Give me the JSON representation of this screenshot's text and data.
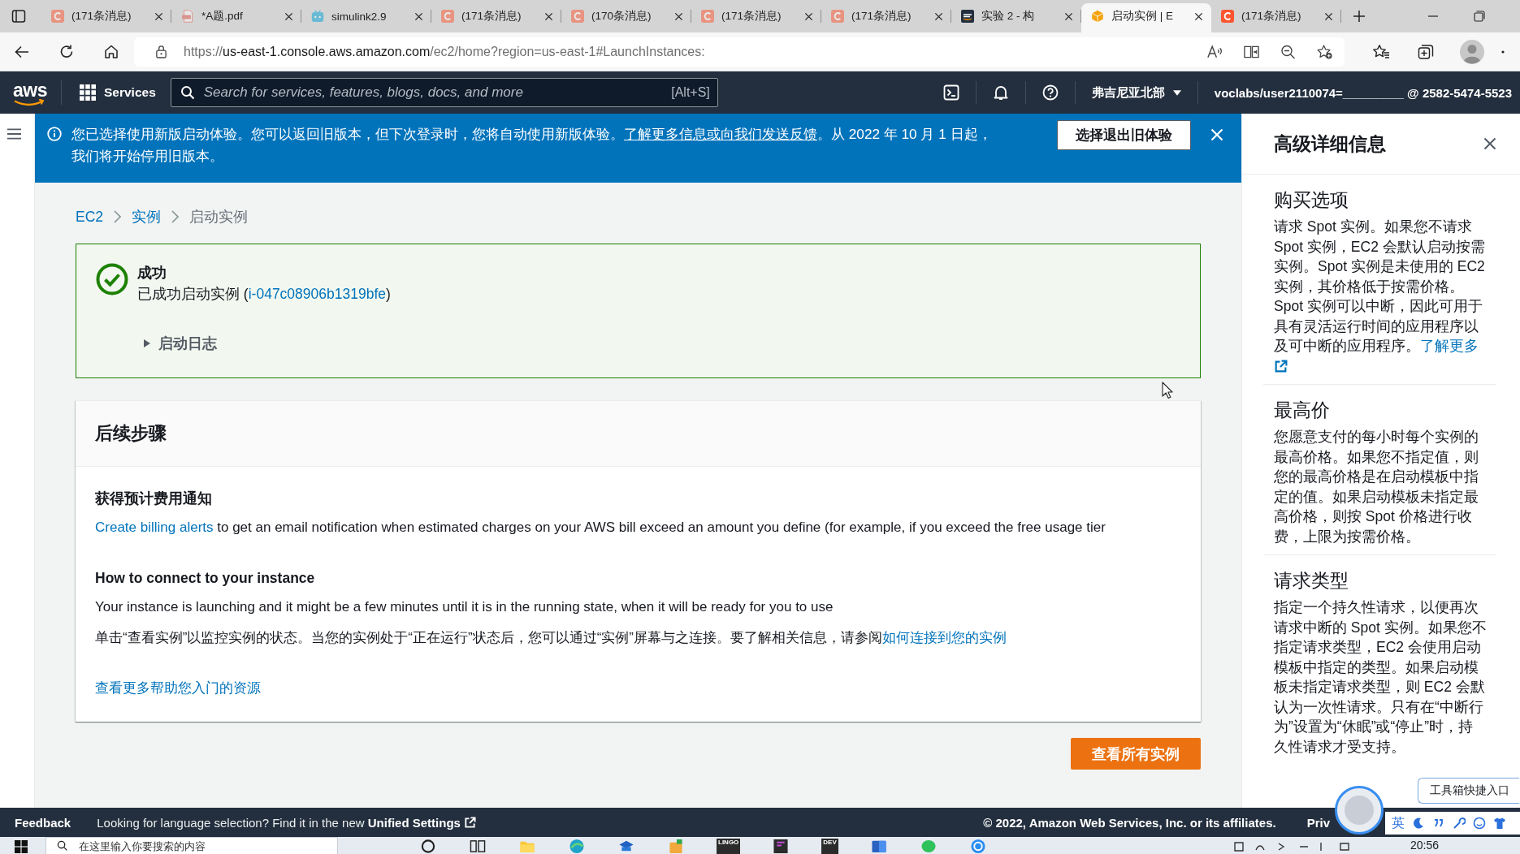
{
  "browser": {
    "tabs": [
      {
        "kind": "csdn",
        "title": "(171条消息)",
        "sleeping": true,
        "selected": false
      },
      {
        "kind": "pdf",
        "title": "*A题.pdf",
        "sleeping": true,
        "selected": false
      },
      {
        "kind": "tv",
        "title": "simulink2.9",
        "sleeping": true,
        "selected": false
      },
      {
        "kind": "csdn",
        "title": "(171条消息)",
        "sleeping": true,
        "selected": false
      },
      {
        "kind": "csdn",
        "title": "(170条消息)",
        "sleeping": true,
        "selected": false
      },
      {
        "kind": "csdn",
        "title": "(171条消息)",
        "sleeping": true,
        "selected": false
      },
      {
        "kind": "csdn",
        "title": "(171条消息)",
        "sleeping": true,
        "selected": false
      },
      {
        "kind": "aws",
        "title": "实验 2 - 构",
        "sleeping": false,
        "selected": false
      },
      {
        "kind": "box",
        "title": "启动实例 | E",
        "sleeping": false,
        "selected": true
      },
      {
        "kind": "csdn",
        "title": "(171条消息)",
        "sleeping": false,
        "selected": false
      }
    ],
    "address": {
      "scheme": "https://",
      "host": "us-east-1.console.aws.amazon.com",
      "path": "/ec2/home?region=us-east-1#LaunchInstances:"
    }
  },
  "aws_nav": {
    "logo": "aws",
    "services": "Services",
    "search": {
      "placeholder": "Search for services, features, blogs, docs, and more",
      "shortcut": "[Alt+S]"
    },
    "region": "弗吉尼亚北部",
    "account": "voclabs/user2110074=_________ @ 2582-5474-5523"
  },
  "banner": {
    "parts": [
      {
        "kind": "text",
        "text": "您已选择使用新版启动体验。您可以返回旧版本，但下次登录时，您将自动使用新版体验。"
      },
      {
        "kind": "link",
        "text": "了解更多信息或向我们发送反馈"
      },
      {
        "kind": "text",
        "text": "。从 2022 年 10 月 1 日起，我们将开始停用旧版本。"
      }
    ],
    "button": "选择退出旧体验"
  },
  "breadcrumb": [
    {
      "kind": "link",
      "label": "EC2"
    },
    {
      "kind": "link",
      "label": "实例"
    },
    {
      "kind": "current",
      "label": "启动实例"
    }
  ],
  "success": {
    "title": "成功",
    "message": [
      {
        "kind": "text",
        "text": "已成功启动实例 ("
      },
      {
        "kind": "link",
        "text": "i-047c08906b1319bfe"
      },
      {
        "kind": "text",
        "text": ")"
      }
    ],
    "log": {
      "label": "启动日志",
      "expanded": false
    }
  },
  "next_steps": {
    "title": "后续步骤",
    "sections": [
      {
        "heading": "获得预计费用通知",
        "paragraphs": [
          [
            {
              "kind": "link",
              "text": "Create billing alerts"
            },
            {
              "kind": "text",
              "text": " to get an email notification when estimated charges on your AWS bill exceed an amount you define (for example, if you exceed the free usage tier"
            }
          ]
        ]
      },
      {
        "heading": "How to connect to your instance",
        "paragraphs": [
          [
            {
              "kind": "text",
              "text": "Your instance is launching and it might be a few minutes until it is in the running state, when it will be ready for you to use"
            }
          ],
          [
            {
              "kind": "text",
              "text": "单击“查看实例”以监控实例的状态。当您的实例处于“正在运行”状态后，您可以通过“实例”屏幕与之连接。要了解相关信息，请参阅"
            },
            {
              "kind": "link",
              "text": "如何连接到您的实例"
            }
          ]
        ]
      },
      {
        "paragraphs": [
          [
            {
              "kind": "link",
              "text": "查看更多帮助您入门的资源"
            }
          ]
        ]
      }
    ]
  },
  "view_all_button": "查看所有实例",
  "side_panel": {
    "title": "高级详细信息",
    "sections": [
      {
        "heading": "购买选项",
        "parts": [
          {
            "kind": "text",
            "text": "请求 Spot 实例。如果您不请求 Spot 实例，EC2 会默认启动按需实例。Spot 实例是未使用的 EC2 实例，其价格低于按需价格。Spot 实例可以中断，因此可用于具有灵活运行时间的应用程序以及可中断的应用程序。"
          },
          {
            "kind": "external-link",
            "text": "了解更多"
          }
        ]
      },
      {
        "heading": "最高价",
        "parts": [
          {
            "kind": "text",
            "text": "您愿意支付的每小时每个实例的最高价格。如果您不指定值，则您的最高价格是在启动模板中指定的值。如果启动模板未指定最高价格，则按 Spot 价格进行收费，上限为按需价格。"
          }
        ]
      },
      {
        "heading": "请求类型",
        "parts": [
          {
            "kind": "text",
            "text": "指定一个持久性请求，以便再次请求中断的 Spot 实例。如果您不指定请求类型，EC2 会使用启动模板中指定的类型。如果启动模板未指定请求类型，则 EC2 会默认为一次性请求。只有在“中断行为”设置为“休眠”或“停止”时，持久性请求才受支持。"
          }
        ]
      }
    ]
  },
  "footer": {
    "feedback": "Feedback",
    "language_note": "Looking for language selection? Find it in the new",
    "settings_link": "Unified Settings",
    "copyright": "© 2022, Amazon Web Services, Inc. or its affiliates.",
    "privacy": "Priv"
  },
  "assistant": {
    "toolbox": "工具箱快捷入口",
    "ime_mode": "英"
  },
  "taskbar": {
    "search": {
      "placeholder": "在这里输入你要搜索的内容"
    },
    "apps": [
      {
        "kind": "ring"
      },
      {
        "kind": "panes"
      },
      {
        "kind": "folder"
      },
      {
        "kind": "globe"
      },
      {
        "kind": "cap"
      },
      {
        "kind": "bag"
      },
      {
        "kind": "label",
        "label": "LINGO"
      },
      {
        "kind": "dark"
      },
      {
        "kind": "label",
        "label": "DEV"
      },
      {
        "kind": "doc"
      },
      {
        "kind": "chat"
      },
      {
        "kind": "round"
      }
    ],
    "time": "20:56"
  }
}
